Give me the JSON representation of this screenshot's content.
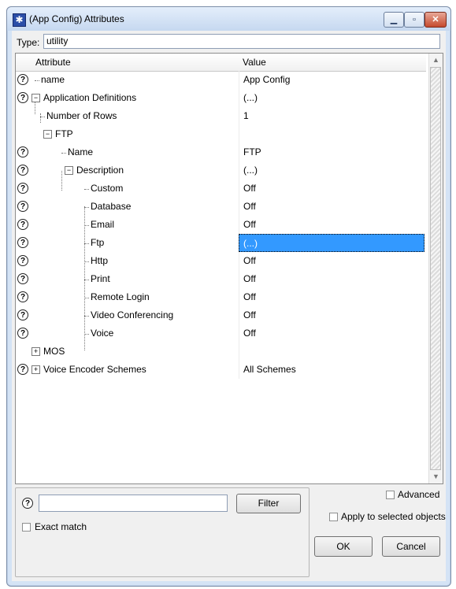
{
  "window": {
    "title": "(App Config) Attributes",
    "icon": "asterisk-app-icon",
    "controls": {
      "minimize": "minimize-icon",
      "maximize": "maximize-icon",
      "close": "close-icon"
    }
  },
  "type_row": {
    "label": "Type:",
    "value": "utility"
  },
  "grid": {
    "headers": {
      "attribute": "Attribute",
      "value": "Value"
    },
    "rows": [
      {
        "help": true,
        "attribute": "name",
        "value": "App Config"
      },
      {
        "help": true,
        "attribute": "Application Definitions",
        "value": "(...)"
      },
      {
        "help": false,
        "attribute": "Number of Rows",
        "value": "1"
      },
      {
        "help": false,
        "attribute": "FTP",
        "value": ""
      },
      {
        "help": true,
        "attribute": "Name",
        "value": "FTP"
      },
      {
        "help": true,
        "attribute": "Description",
        "value": "(...)"
      },
      {
        "help": true,
        "attribute": "Custom",
        "value": "Off"
      },
      {
        "help": true,
        "attribute": "Database",
        "value": "Off"
      },
      {
        "help": true,
        "attribute": "Email",
        "value": "Off"
      },
      {
        "help": true,
        "attribute": "Ftp",
        "value": "(...)",
        "selected": true
      },
      {
        "help": true,
        "attribute": "Http",
        "value": "Off"
      },
      {
        "help": true,
        "attribute": "Print",
        "value": "Off"
      },
      {
        "help": true,
        "attribute": "Remote Login",
        "value": "Off"
      },
      {
        "help": true,
        "attribute": "Video Conferencing",
        "value": "Off"
      },
      {
        "help": true,
        "attribute": "Voice",
        "value": "Off"
      },
      {
        "help": false,
        "attribute": "MOS",
        "value": ""
      },
      {
        "help": true,
        "attribute": "Voice Encoder Schemes",
        "value": "All Schemes"
      }
    ]
  },
  "filter": {
    "input_value": "",
    "filter_button": "Filter",
    "exact_match_label": "Exact match"
  },
  "options": {
    "advanced_label": "Advanced",
    "apply_label": "Apply to selected objects"
  },
  "buttons": {
    "ok": "OK",
    "cancel": "Cancel"
  },
  "colors": {
    "selection": "#3399ff",
    "title_bar": "#c6d8f0"
  }
}
